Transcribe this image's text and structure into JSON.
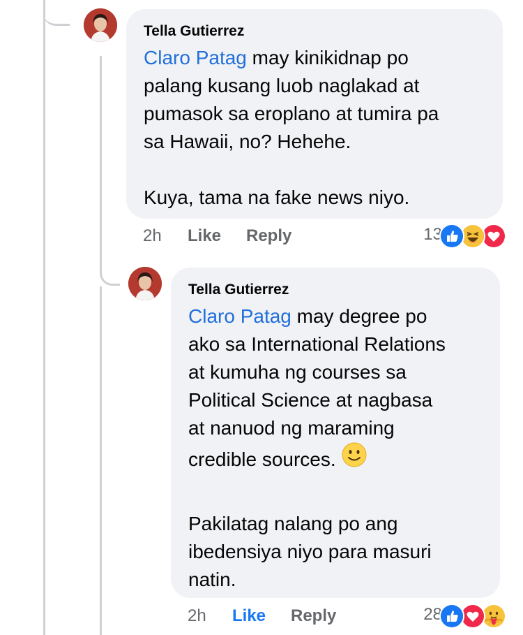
{
  "comments": [
    {
      "author": "Tella Gutierrez",
      "mention": "Claro Patag",
      "lines": [
        " may kinikidnap po",
        "palang kusang luob naglakad at",
        "pumasok sa eroplano at tumira pa",
        "sa Hawaii, no? Hehehe."
      ],
      "lines2": [
        "Kuya, tama na fake news niyo."
      ],
      "time": "2h",
      "like": "Like",
      "reply": "Reply",
      "reaction_count": "13",
      "reactions": [
        "like-reaction-icon",
        "haha-reaction-icon",
        "love-reaction-icon"
      ]
    },
    {
      "author": "Tella Gutierrez",
      "mention": "Claro Patag",
      "lines": [
        " may degree po",
        "ako sa International Relations",
        "at kumuha ng courses sa",
        "Political Science at nagbasa",
        "at nanuod ng maraming",
        "credible sources."
      ],
      "lines2": [
        "Pakilatag nalang po ang",
        "ibedensiya niyo para masuri",
        "natin."
      ],
      "time": "2h",
      "like": "Like",
      "reply": "Reply",
      "reaction_count": "28",
      "reactions": [
        "like-reaction-icon",
        "love-reaction-icon",
        "care-reaction-icon"
      ]
    }
  ],
  "colors": {
    "mention": "#216fdb",
    "bubble": "#f0f2f5",
    "liked": "#1877f2",
    "meta": "#65676b"
  }
}
